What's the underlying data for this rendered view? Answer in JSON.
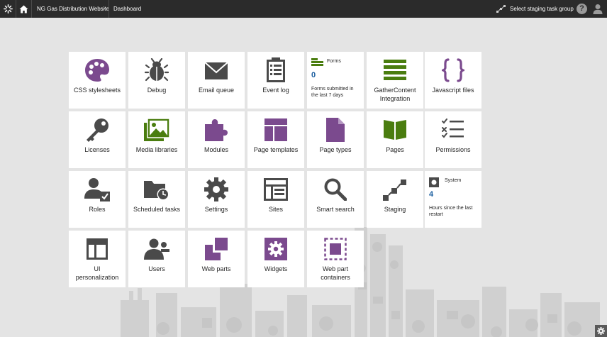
{
  "topbar": {
    "site_name": "NG Gas Distribution Website",
    "breadcrumb": "Dashboard",
    "staging_label": "Select staging task group",
    "help_label": "?"
  },
  "tiles": [
    {
      "label": "CSS stylesheets",
      "icon": "palette-icon"
    },
    {
      "label": "Debug",
      "icon": "bug-icon"
    },
    {
      "label": "Email queue",
      "icon": "envelope-icon"
    },
    {
      "label": "Event log",
      "icon": "clipboard-list-icon"
    },
    {
      "label": "Forms",
      "icon": "forms-icon",
      "value": "0",
      "description": "Forms submitted in the last 7 days"
    },
    {
      "label": "GatherContent Integration",
      "icon": "gathercontent-icon"
    },
    {
      "label": "Javascript files",
      "icon": "braces-icon"
    },
    {
      "label": "Licenses",
      "icon": "key-icon"
    },
    {
      "label": "Media libraries",
      "icon": "images-icon"
    },
    {
      "label": "Modules",
      "icon": "puzzle-icon"
    },
    {
      "label": "Page templates",
      "icon": "template-icon"
    },
    {
      "label": "Page types",
      "icon": "document-icon"
    },
    {
      "label": "Pages",
      "icon": "book-icon"
    },
    {
      "label": "Permissions",
      "icon": "checklist-icon"
    },
    {
      "label": "Roles",
      "icon": "user-check-icon"
    },
    {
      "label": "Scheduled tasks",
      "icon": "folder-clock-icon"
    },
    {
      "label": "Settings",
      "icon": "gear-icon"
    },
    {
      "label": "Sites",
      "icon": "sites-icon"
    },
    {
      "label": "Smart search",
      "icon": "magnifier-icon"
    },
    {
      "label": "Staging",
      "icon": "staging-icon"
    },
    {
      "label": "System",
      "icon": "system-icon",
      "value": "4",
      "description": "Hours since the last restart"
    },
    {
      "label": "UI personalization",
      "icon": "ui-layout-icon"
    },
    {
      "label": "Users",
      "icon": "users-icon"
    },
    {
      "label": "Web parts",
      "icon": "webparts-icon"
    },
    {
      "label": "Widgets",
      "icon": "widget-gear-icon"
    },
    {
      "label": "Web part containers",
      "icon": "container-icon"
    }
  ],
  "colors": {
    "topbar": "#2b2b2b",
    "background": "#e4e4e4",
    "purple": "#7b4a8e",
    "green": "#4a7d0f",
    "dark_icon": "#4a4a4a",
    "live_number": "#1c5fa0"
  }
}
